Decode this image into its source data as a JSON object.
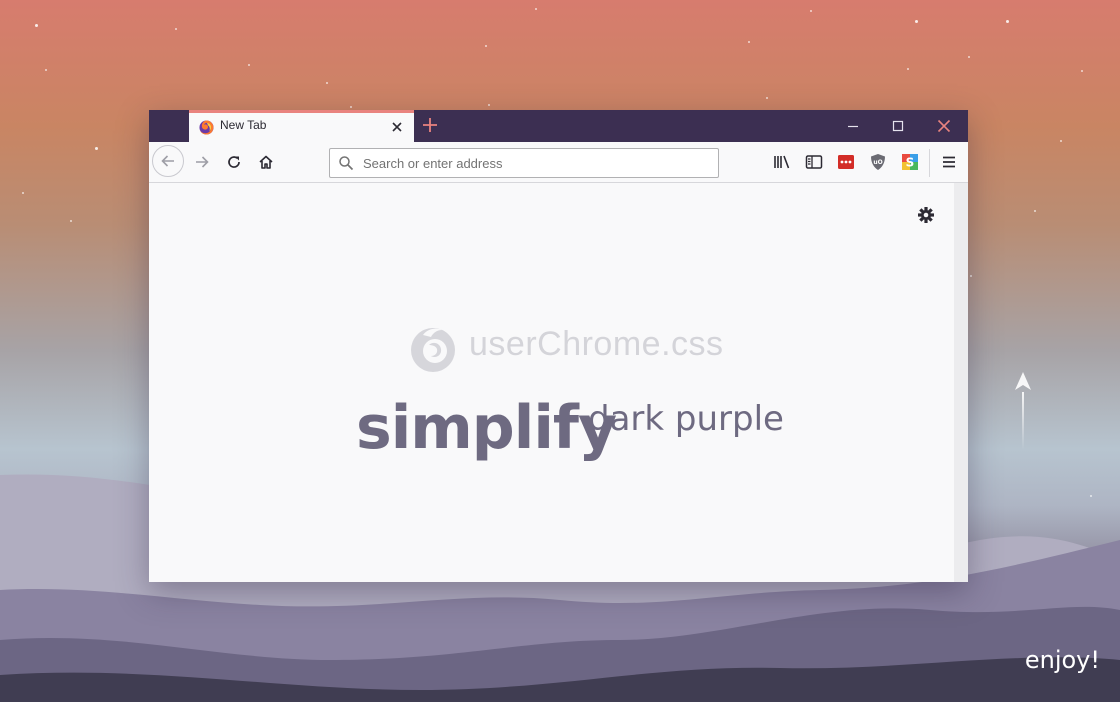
{
  "tab": {
    "title": "New Tab"
  },
  "toolbar": {
    "url_placeholder": "Search or enter address"
  },
  "newtab_page": {
    "brand_text": "userChrome.css",
    "headline_main": "simplify",
    "headline_sub": "dark purple"
  },
  "desktop": {
    "caption": "enjoy!"
  },
  "icons": {
    "back": "back-arrow-icon",
    "forward": "forward-arrow-icon",
    "reload": "reload-icon",
    "home": "home-icon",
    "library": "library-icon",
    "sidebar": "sidebar-icon",
    "lastpass": "lastpass-icon",
    "ublock": "ublock-icon",
    "stylus": "stylus-icon",
    "menu": "hamburger-menu-icon",
    "settings": "gear-icon"
  },
  "colors": {
    "titlebar": "#3c2f52",
    "tab_accent": "#e9837f",
    "close_accent": "#e9837f",
    "headline": "#6e6a81",
    "brand_muted": "#d4d4d9"
  }
}
